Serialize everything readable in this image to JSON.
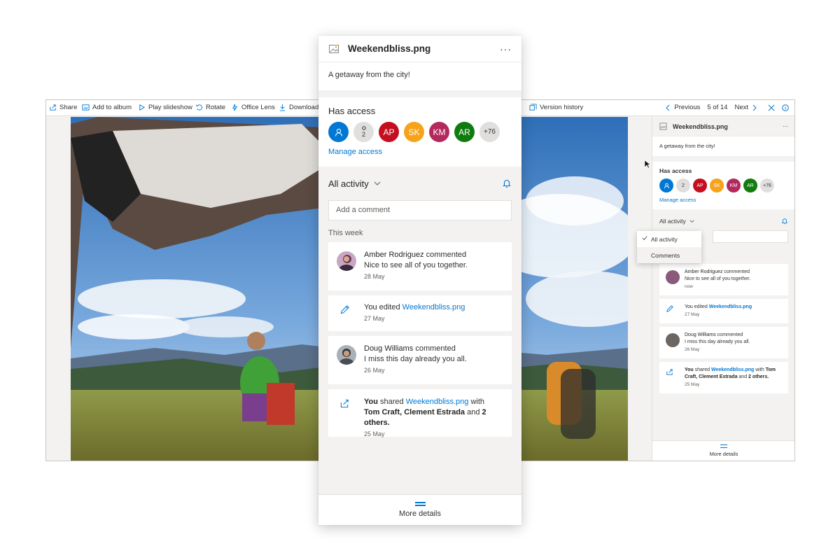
{
  "viewer": {
    "toolbar": [
      {
        "label": "Share",
        "icon": "share-icon"
      },
      {
        "label": "Add to album",
        "icon": "album-icon"
      },
      {
        "label": "Play slideshow",
        "icon": "play-icon"
      },
      {
        "label": "Rotate",
        "icon": "rotate-icon"
      },
      {
        "label": "Office Lens",
        "icon": "lens-icon"
      },
      {
        "label": "Download",
        "icon": "download-icon"
      },
      {
        "label": "Version history",
        "icon": "history-icon"
      }
    ],
    "pager": {
      "previous": "Previous",
      "count": "5 of 14",
      "next": "Next"
    }
  },
  "mini_panel": {
    "file_name": "Weekendbliss.png",
    "description": "A getaway from the city!",
    "has_access": "Has access",
    "avatars": [
      {
        "initials": "",
        "color": "#0078d4"
      },
      {
        "initials": "2",
        "color": "#e1dfdd"
      },
      {
        "initials": "AP",
        "color": "#c50f1f"
      },
      {
        "initials": "SK",
        "color": "#f7a21b"
      },
      {
        "initials": "KM",
        "color": "#b4295d"
      },
      {
        "initials": "AR",
        "color": "#107c10"
      },
      {
        "initials": "+76",
        "color": "#e1dfdd"
      }
    ],
    "manage_access": "Manage access",
    "activity_filter": "All activity",
    "dropdown": [
      "All activity",
      "Comments"
    ],
    "feed": [
      {
        "name": "Amber Rodriguez",
        "action": " commented",
        "text": "Nice to see all of you together.",
        "date": "now"
      },
      {
        "prefix": "You",
        "action": " edited ",
        "link": "Weekendbliss.png",
        "date": "27 May"
      },
      {
        "name": "Doug Williams",
        "action": " commented",
        "text": "I miss this day already you all.",
        "date": "26 May"
      },
      {
        "prefix": "You",
        "action": " shared ",
        "link": "Weekendbliss.png",
        "with": " with ",
        "people": "Tom Craft, Clement Estrada",
        "and": " and ",
        "others": "2 others.",
        "date": "25 May"
      }
    ],
    "more_details": "More details"
  },
  "panel": {
    "file_name": "Weekendbliss.png",
    "description": "A getaway from the city!",
    "has_access": "Has access",
    "avatars": [
      {
        "initials": "",
        "color": "#0078d4"
      },
      {
        "initials": "2",
        "color": "#e1dfdd"
      },
      {
        "initials": "AP",
        "color": "#c50f1f"
      },
      {
        "initials": "SK",
        "color": "#f7a21b"
      },
      {
        "initials": "KM",
        "color": "#b4295d"
      },
      {
        "initials": "AR",
        "color": "#107c10"
      },
      {
        "initials": "+76",
        "color": "#e1dfdd"
      }
    ],
    "manage_access": "Manage access",
    "activity_filter": "All activity",
    "comment_placeholder": "Add a comment",
    "section": "This week",
    "feed": [
      {
        "name": "Amber Rodriguez",
        "action": " commented",
        "text": "Nice to see all of you together.",
        "date": "28 May"
      },
      {
        "prefix": "You",
        "action": " edited ",
        "link": "Weekendbliss.png",
        "date": "27 May"
      },
      {
        "name": "Doug Williams",
        "action": " commented",
        "text": "I miss this day already you all.",
        "date": "26 May"
      },
      {
        "prefix": "You",
        "action": " shared ",
        "link": "Weekendbliss.png",
        "with": " with",
        "people": "Tom Craft, Clement Estrada",
        "and": " and ",
        "others": "2 others.",
        "date": "25 May"
      }
    ],
    "more_details": "More details"
  }
}
